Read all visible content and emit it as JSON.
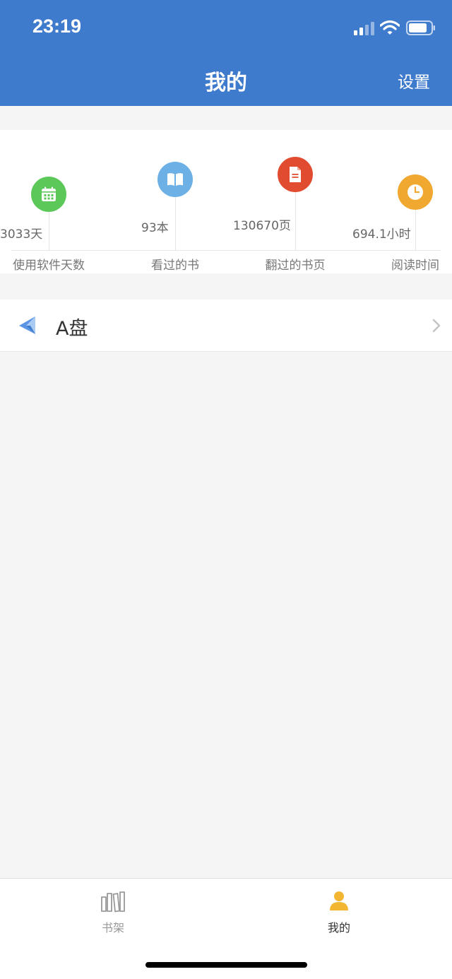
{
  "status_bar": {
    "time": "23:19"
  },
  "header": {
    "title": "我的",
    "settings_label": "设置"
  },
  "stats": [
    {
      "value": "3033天",
      "label": "使用软件天数",
      "icon": "calendar-icon",
      "color": "#5cc85a"
    },
    {
      "value": "93本",
      "label": "看过的书",
      "icon": "book-icon",
      "color": "#6cb0e6"
    },
    {
      "value": "130670页",
      "label": "翻过的书页",
      "icon": "document-icon",
      "color": "#e14c30"
    },
    {
      "value": "694.1小时",
      "label": "阅读时间",
      "icon": "clock-icon",
      "color": "#f0a830"
    }
  ],
  "list": {
    "item_label": "A盘",
    "icon": "paper-plane-icon"
  },
  "tabbar": {
    "bookshelf_label": "书架",
    "mine_label": "我的",
    "inactive_color": "#999999",
    "active_color": "#333333",
    "active_icon_color": "#f2b632"
  }
}
